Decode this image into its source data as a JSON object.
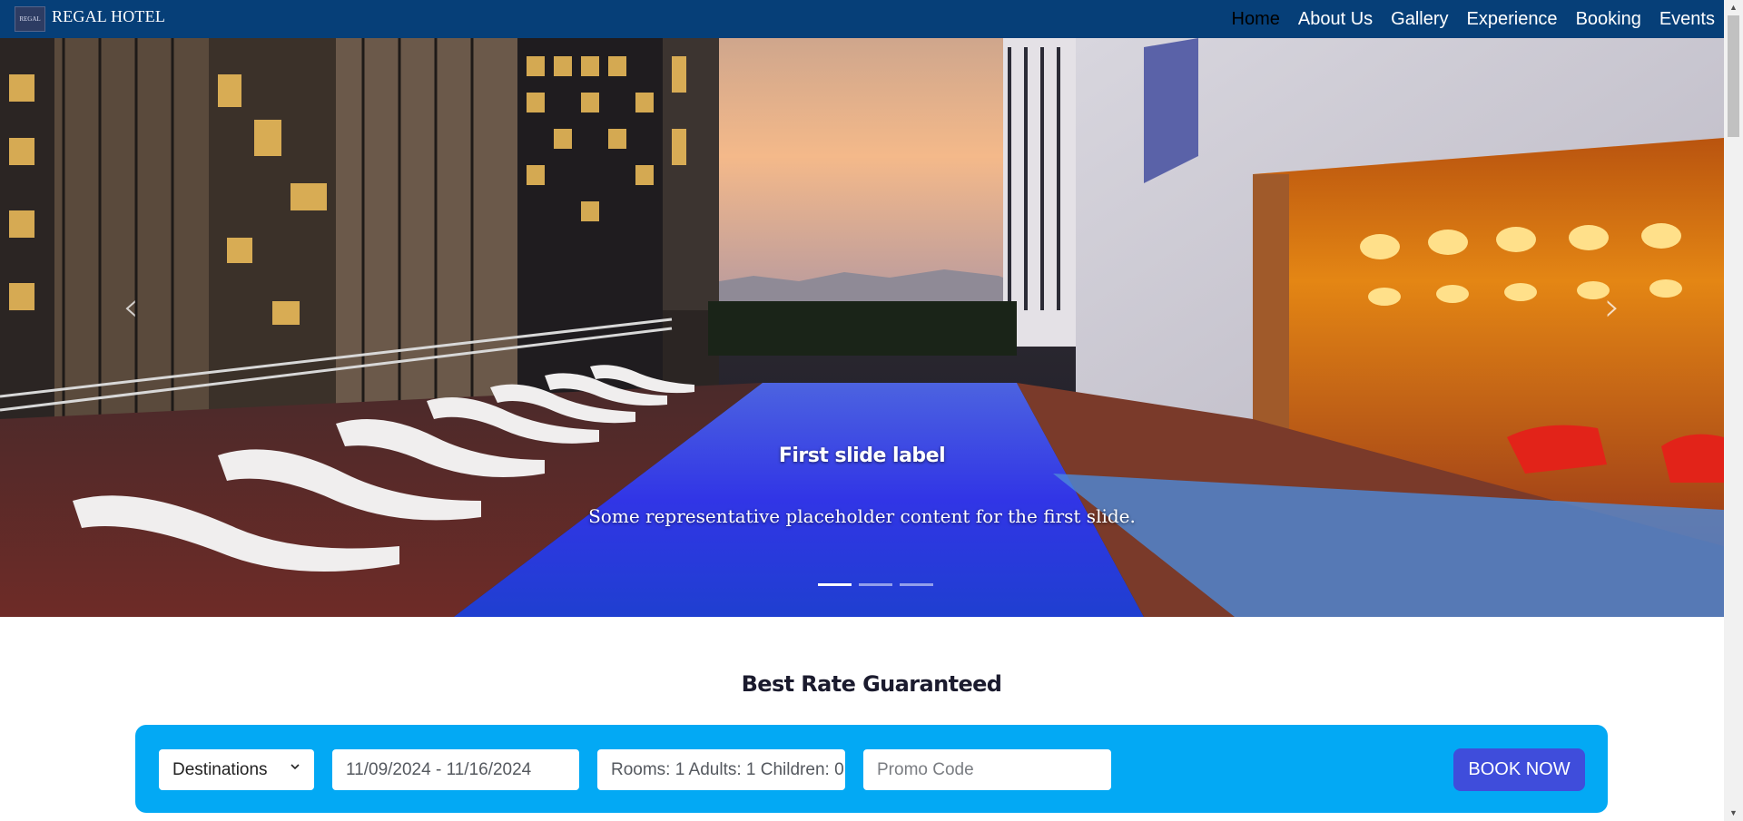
{
  "brand": {
    "name": "REGAL HOTEL",
    "logo_text": "REGAL"
  },
  "nav": [
    {
      "label": "Home",
      "active": true
    },
    {
      "label": "About Us"
    },
    {
      "label": "Gallery"
    },
    {
      "label": "Experience"
    },
    {
      "label": "Booking"
    },
    {
      "label": "Events"
    }
  ],
  "carousel": {
    "slide_title": "First slide label",
    "slide_text": "Some representative placeholder content for the first slide.",
    "slide_count": 3,
    "active_slide": 1,
    "prev_icon": "chevron-left-icon",
    "next_icon": "chevron-right-icon"
  },
  "booking": {
    "title": "Best Rate Guaranteed",
    "destination": "Destinations",
    "dates": "11/09/2024 - 11/16/2024",
    "guests": "Rooms: 1 Adults: 1 Children: 0",
    "promo_placeholder": "Promo Code",
    "book_label": "BOOK NOW"
  },
  "colors": {
    "navbar": "#063f78",
    "booking_bar": "#03a9f4",
    "book_button": "#3f4ddb",
    "active_nav": "#000000"
  }
}
